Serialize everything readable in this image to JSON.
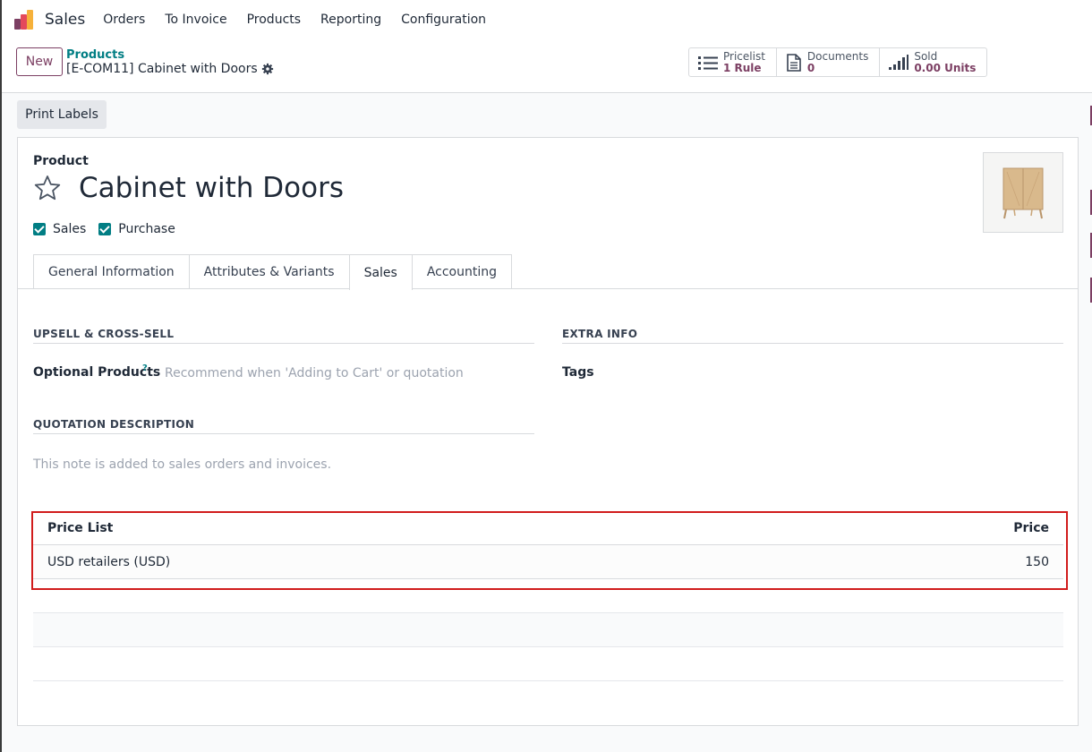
{
  "app": {
    "name": "Sales",
    "menu": [
      "Orders",
      "To Invoice",
      "Products",
      "Reporting",
      "Configuration"
    ]
  },
  "control_panel": {
    "new_label": "New",
    "breadcrumb_parent": "Products",
    "breadcrumb_current": "[E-COM11] Cabinet with Doors",
    "smart_buttons": [
      {
        "label": "Pricelist",
        "value": "1 Rule",
        "icon": "list-icon"
      },
      {
        "label": "Documents",
        "value": "0",
        "icon": "file-icon"
      },
      {
        "label": "Sold",
        "value": "0.00 Units",
        "icon": "bar-chart-icon"
      }
    ]
  },
  "status": {
    "print_labels": "Print Labels"
  },
  "form": {
    "product_label": "Product",
    "product_name": "Cabinet with Doors",
    "checkboxes": [
      {
        "label": "Sales",
        "checked": true
      },
      {
        "label": "Purchase",
        "checked": true
      }
    ],
    "tabs": [
      "General Information",
      "Attributes & Variants",
      "Sales",
      "Accounting"
    ],
    "active_tab": "Sales",
    "upsell_title": "UPSELL & CROSS-SELL",
    "optional_products_label": "Optional Products",
    "help_mark": "?",
    "optional_products_placeholder": "Recommend when 'Adding to Cart' or quotation",
    "extra_info_title": "EXTRA INFO",
    "tags_label": "Tags",
    "quotation_title": "QUOTATION DESCRIPTION",
    "quotation_placeholder": "This note is added to sales orders and invoices.",
    "pricelist_table": {
      "columns": [
        "Price List",
        "Price"
      ],
      "rows": [
        {
          "pricelist": "USD retailers (USD)",
          "price": "150"
        }
      ]
    }
  },
  "colors": {
    "brand": "#7c3f63",
    "accent": "#017e84",
    "highlight": "#d11c1c"
  }
}
